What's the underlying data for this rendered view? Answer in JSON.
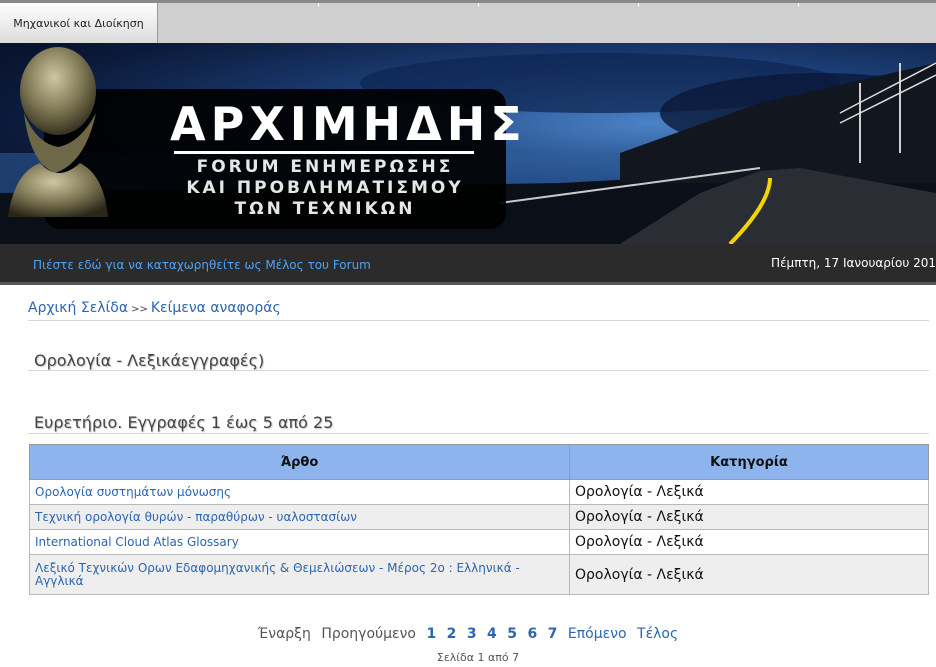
{
  "tabs": {
    "active_label": "Μηχανικοί και Διοίκηση"
  },
  "banner": {
    "title": "ΑΡΧΙΜΗΔΗΣ",
    "subtitle_line1": "FORUM ΕΝΗΜΕΡΩΣΗΣ",
    "subtitle_line2": "ΚΑΙ ΠΡΟΒΛΗΜΑΤΙΣΜΟΥ",
    "subtitle_line3": "ΤΩΝ ΤΕΧΝΙΚΩΝ"
  },
  "strip": {
    "register_link": "Πιέστε εδώ για να καταχωρηθείτε ως Μέλος του Forum",
    "date": "Πέμπτη, 17 Ιανουαρίου 201"
  },
  "breadcrumb": {
    "home": "Αρχική Σελίδα",
    "separator": ">>",
    "current": "Κείμενα αναφοράς"
  },
  "section_title": "Ορολογία - Λεξικάεγγραφές)",
  "index_title": "Ευρετήριο. Εγγραφές 1 έως 5 από 25",
  "table": {
    "col_article": "Άρθο",
    "col_category": "Κατηγορία",
    "rows": [
      {
        "article": "Ορολογία συστημάτων μόνωσης",
        "category": "Ορολογία - Λεξικά"
      },
      {
        "article": "Τεχνική ορολογία θυρών - παραθύρων - υαλοστασίων",
        "category": "Ορολογία - Λεξικά"
      },
      {
        "article": "International Cloud Atlas Glossary",
        "category": "Ορολογία - Λεξικά"
      },
      {
        "article": "Λεξικό Τεχνικών Ορων Εδαφομηχανικής & Θεμελιώσεων - Μέρος 2ο : Ελληνικά - Αγγλικά",
        "category": "Ορολογία - Λεξικά"
      }
    ]
  },
  "pager": {
    "start": "Έναρξη",
    "prev": "Προηγούμενο",
    "pages": [
      "1",
      "2",
      "3",
      "4",
      "5",
      "6",
      "7"
    ],
    "next": "Επόμενο",
    "end": "Τέλος",
    "page_info": "Σελίδα 1 από 7"
  },
  "colors": {
    "link": "#2b66b0",
    "table_header": "#8eb4ee",
    "strip_bg": "#2b2b2b",
    "strip_link": "#4ea3f5"
  }
}
